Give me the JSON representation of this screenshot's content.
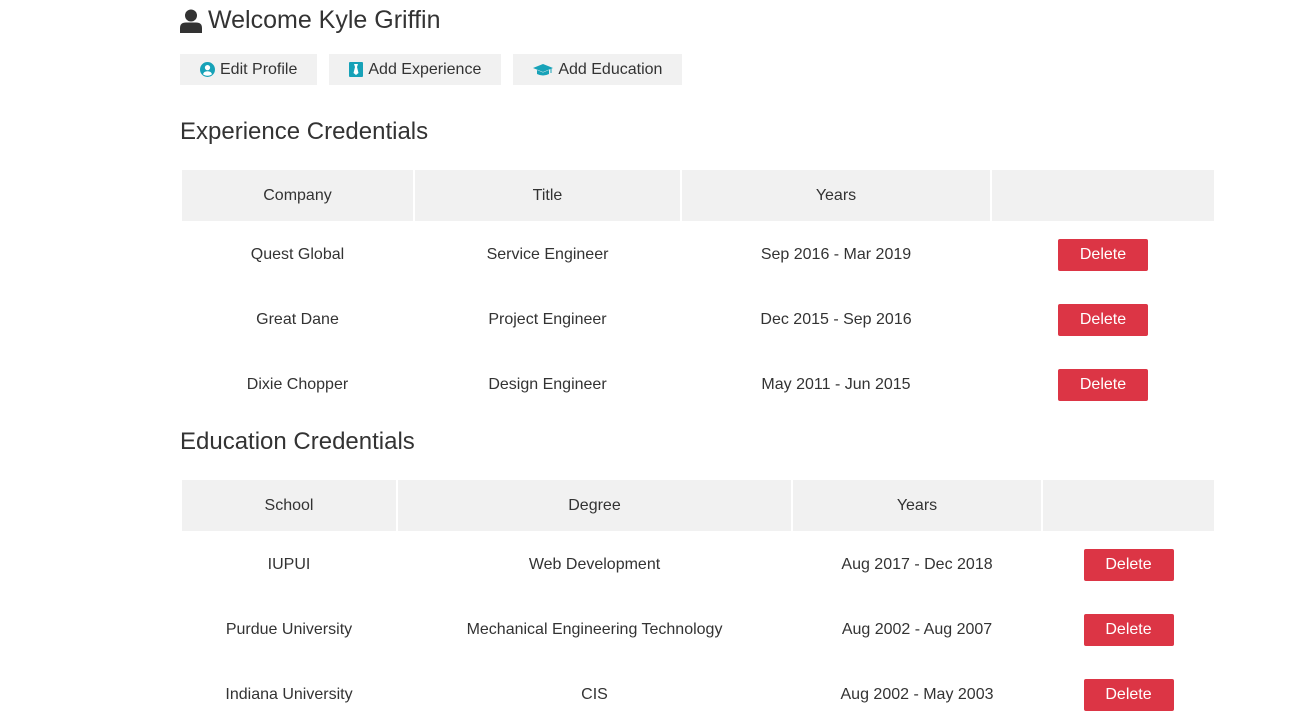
{
  "header": {
    "welcome_text": "Welcome Kyle Griffin"
  },
  "actions": {
    "edit_profile": {
      "label": "Edit Profile",
      "icon": "user-circle-icon"
    },
    "add_experience": {
      "label": "Add Experience",
      "icon": "black-tie-icon"
    },
    "add_education": {
      "label": "Add Education",
      "icon": "graduation-cap-icon"
    }
  },
  "experience": {
    "title": "Experience Credentials",
    "columns": [
      "Company",
      "Title",
      "Years",
      ""
    ],
    "rows": [
      {
        "company": "Quest Global",
        "title": "Service Engineer",
        "years": "Sep 2016 - Mar 2019",
        "action": "Delete"
      },
      {
        "company": "Great Dane",
        "title": "Project Engineer",
        "years": "Dec 2015 - Sep 2016",
        "action": "Delete"
      },
      {
        "company": "Dixie Chopper",
        "title": "Design Engineer",
        "years": "May 2011 - Jun 2015",
        "action": "Delete"
      }
    ]
  },
  "education": {
    "title": "Education Credentials",
    "columns": [
      "School",
      "Degree",
      "Years",
      ""
    ],
    "rows": [
      {
        "school": "IUPUI",
        "degree": "Web Development",
        "years": "Aug 2017 - Dec 2018",
        "action": "Delete"
      },
      {
        "school": "Purdue University",
        "degree": "Mechanical Engineering Technology",
        "years": "Aug 2002 - Aug 2007",
        "action": "Delete"
      },
      {
        "school": "Indiana University",
        "degree": "CIS",
        "years": "Aug 2002 - May 2003",
        "action": "Delete"
      }
    ]
  },
  "colors": {
    "accent": "#17a2b8",
    "danger": "#dc3545",
    "light": "#f1f1f1",
    "text": "#333333"
  }
}
